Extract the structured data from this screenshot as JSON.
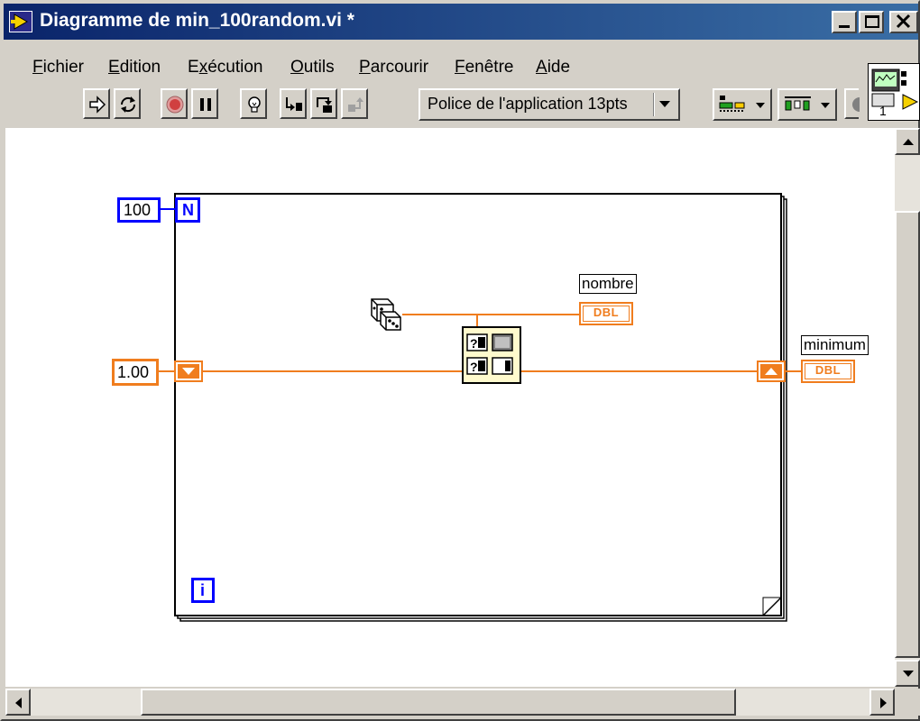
{
  "window": {
    "title": "Diagramme de min_100random.vi *"
  },
  "menu": [
    {
      "label": "Fichier",
      "u": "F",
      "rest": "ichier"
    },
    {
      "label": "Edition",
      "u": "E",
      "rest": "dition"
    },
    {
      "label": "Exécution",
      "u_pre": "E",
      "u": "x",
      "rest": "écution"
    },
    {
      "label": "Outils",
      "u": "O",
      "rest": "utils"
    },
    {
      "label": "Parcourir",
      "u": "P",
      "rest": "arcourir"
    },
    {
      "label": "Fenêtre",
      "u": "F",
      "rest": "enêtre"
    },
    {
      "label": "Aide",
      "u": "A",
      "rest": "ide"
    }
  ],
  "toolbar": {
    "font_label": "Police de l'application 13pts"
  },
  "vi_icon": {
    "number": "1"
  },
  "diagram": {
    "count_constant": "100",
    "count_terminal": "N",
    "iteration_terminal": "i",
    "init_constant": "1.00",
    "indicator_nombre": "nombre",
    "indicator_minimum": "minimum",
    "dbl_type": "DBL"
  },
  "colors": {
    "wire_orange": "#f07d1e",
    "terminal_blue": "#0000ff",
    "titlebar": "#0a246a",
    "face": "#d4d0c8"
  }
}
